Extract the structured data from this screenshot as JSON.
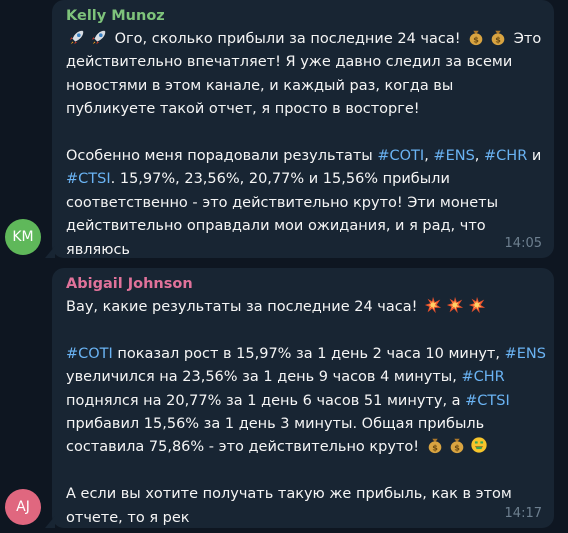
{
  "colors": {
    "background": "#0e1621",
    "bubble": "#182533",
    "text": "#f5f5f5",
    "hashtag": "#6ab3f3",
    "timestamp": "#6d7f8f"
  },
  "messages": [
    {
      "sender": "Kelly Munoz",
      "sender_color": "#7ec37b",
      "avatar_initials": "KM",
      "avatar_color": "#5fb85a",
      "time": "14:05",
      "parts": {
        "p1": " Ого, сколько прибыли за последние 24 часа! ",
        "p2": " Это действительно впечатляет! Я уже давно следил за всеми новостями в этом канале, и каждый раз, когда вы публикуете такой отчет, я просто в восторге!\n\nОсобенно меня порадовали результаты ",
        "tag1": "#COTI",
        "sep1": ", ",
        "tag2": "#ENS",
        "sep2": ", ",
        "tag3": "#CHR",
        "sep3": " и\n",
        "tag4": "#CTSI",
        "p3": ". 15,97%, 23,56%, 20,77% и 15,56% прибыли соответственно - это действительно круто! Эти монеты действительно оправдали мои ожидания, и я рад, что являюсь"
      },
      "emojis": [
        "rocket",
        "rocket",
        "money-bag",
        "money-bag"
      ]
    },
    {
      "sender": "Abigail Johnson",
      "sender_color": "#e0729a",
      "avatar_initials": "AJ",
      "avatar_color": "#e0677f",
      "time": "14:17",
      "parts": {
        "p1": "Вау, какие результаты за последние 24 часа! ",
        "p2": "\n\n",
        "tag1": "#COTI",
        "p3": " показал рост в 15,97% за 1 день 2 часа 10 минут, ",
        "tag2": "#ENS",
        "p4": "\nувеличился на 23,56% за 1 день 9 часов 4 минуты, ",
        "tag3": "#CHR",
        "p5": "\nподнялся на 20,77% за 1 день 6 часов 51 минуту, а ",
        "tag4": "#CTSI",
        "p6": "\nприбавил 15,56% за 1 день 3 минуты. Общая прибыль составила 75,86% - это действительно круто! ",
        "p7": "\n\nА если вы хотите получать такую же прибыль, как в этом отчете, то я рек"
      },
      "emojis": [
        "collision",
        "collision",
        "collision",
        "money-bag",
        "money-bag",
        "money-mouth-face"
      ]
    }
  ]
}
